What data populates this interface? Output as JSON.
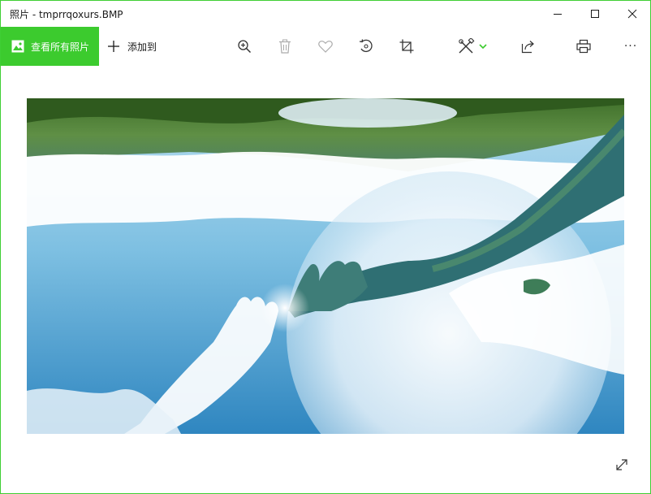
{
  "window": {
    "title": "照片 - tmprrqoxurs.BMP",
    "accent_color": "#3ccb2e",
    "border_color": "#3fcf34"
  },
  "titlebar": {
    "buttons": [
      {
        "name": "minimize",
        "icon": "minimize-icon"
      },
      {
        "name": "maximize",
        "icon": "maximize-icon"
      },
      {
        "name": "close",
        "icon": "close-icon"
      }
    ]
  },
  "toolbar": {
    "see_all_label": "查看所有照片",
    "add_to_label": "添加到",
    "icons": [
      "zoom-icon",
      "delete-icon",
      "favorite-icon",
      "rotate-icon",
      "crop-icon",
      "edit-icon",
      "share-icon",
      "print-icon",
      "more-icon"
    ],
    "more_label": "···"
  },
  "photo": {
    "description_icon": "image-photo"
  },
  "footer": {
    "expand_icon": "fullscreen-expand-icon"
  }
}
